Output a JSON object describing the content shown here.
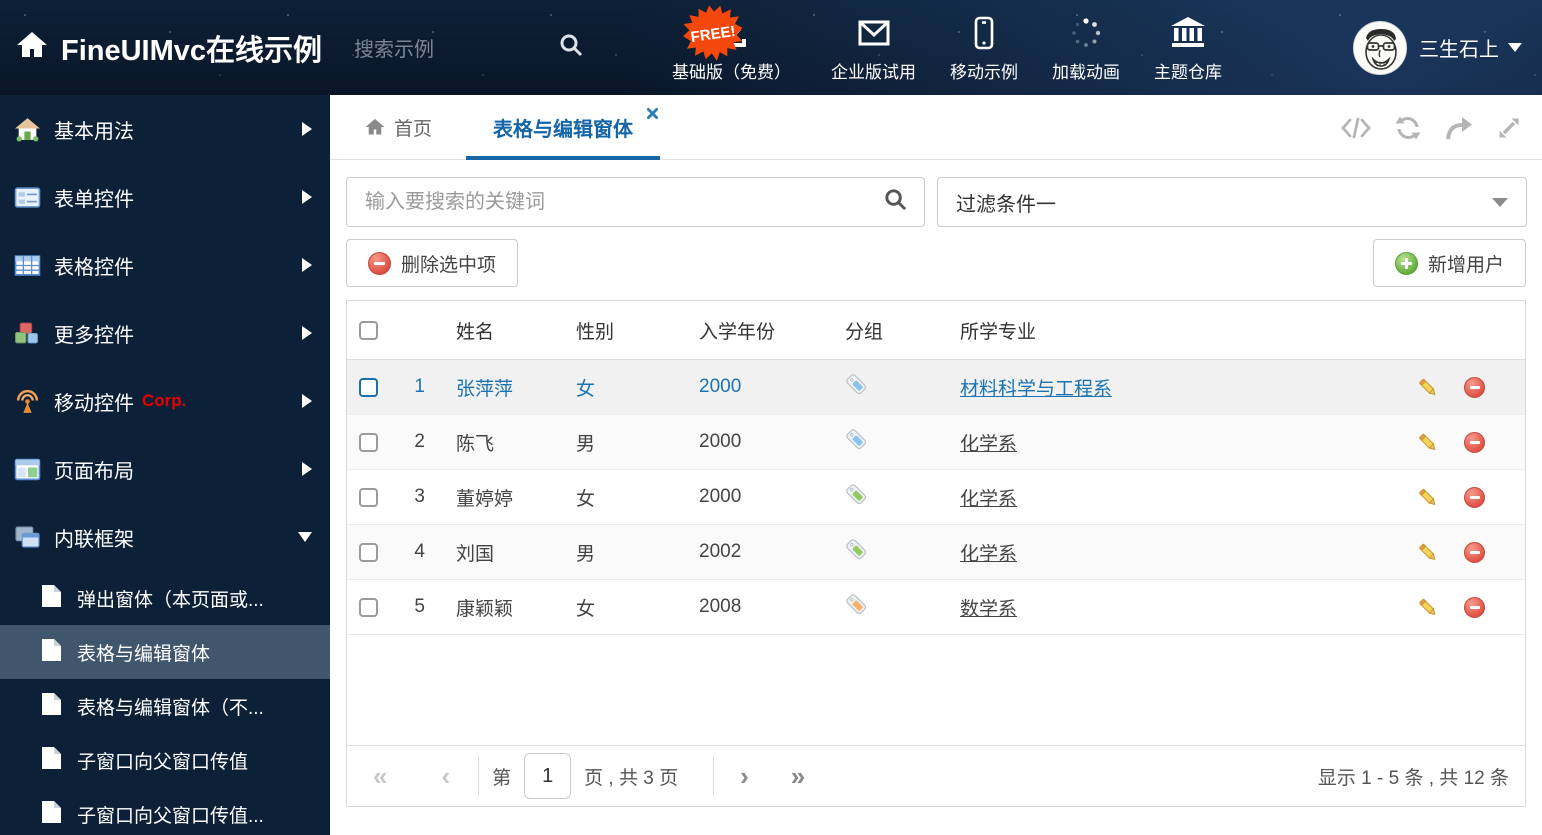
{
  "colors": {
    "accent_blue": "#1565a7",
    "selected_row_blue": "#1b74b2",
    "header_bg": "#0b1b30",
    "free_badge_bg": "#f4470b",
    "delete_red": "#dd4f42",
    "add_green": "#62ad3c",
    "tag_blue": "#85c5ef",
    "tag_green": "#94ca62",
    "tag_orange": "#f7b267",
    "corp_red": "#e80000"
  },
  "header": {
    "title": "FineUIMvc在线示例",
    "search_placeholder": "搜索示例",
    "free_badge": "FREE!",
    "nav_items": [
      {
        "label": "基础版（免费）"
      },
      {
        "label": "企业版试用"
      },
      {
        "label": "移动示例"
      },
      {
        "label": "加载动画"
      },
      {
        "label": "主题仓库"
      }
    ],
    "username": "三生石上"
  },
  "sidebar": {
    "items": [
      {
        "label": "基本用法"
      },
      {
        "label": "表单控件"
      },
      {
        "label": "表格控件"
      },
      {
        "label": "更多控件"
      },
      {
        "label": "移动控件",
        "badge": "Corp."
      },
      {
        "label": "页面布局"
      },
      {
        "label": "内联框架"
      }
    ],
    "subitems": [
      {
        "label": "弹出窗体（本页面或..."
      },
      {
        "label": "表格与编辑窗体"
      },
      {
        "label": "表格与编辑窗体（不..."
      },
      {
        "label": "子窗口向父窗口传值"
      },
      {
        "label": "子窗口向父窗口传值..."
      }
    ]
  },
  "tabs": {
    "home_label": "首页",
    "active_label": "表格与编辑窗体"
  },
  "filter": {
    "search_placeholder": "输入要搜索的关键词",
    "dropdown_value": "过滤条件一"
  },
  "toolbar": {
    "delete_label": "删除选中项",
    "add_label": "新增用户"
  },
  "table": {
    "columns": {
      "name": "姓名",
      "gender": "性别",
      "year": "入学年份",
      "group": "分组",
      "major": "所学专业"
    },
    "rows": [
      {
        "num": "1",
        "name": "张萍萍",
        "gender": "女",
        "year": "2000",
        "major": "材料科学与工程系",
        "tag": "blue",
        "selected": true
      },
      {
        "num": "2",
        "name": "陈飞",
        "gender": "男",
        "year": "2000",
        "major": "化学系",
        "tag": "blue"
      },
      {
        "num": "3",
        "name": "董婷婷",
        "gender": "女",
        "year": "2000",
        "major": "化学系",
        "tag": "green"
      },
      {
        "num": "4",
        "name": "刘国",
        "gender": "男",
        "year": "2002",
        "major": "化学系",
        "tag": "green"
      },
      {
        "num": "5",
        "name": "康颖颖",
        "gender": "女",
        "year": "2008",
        "major": "数学系",
        "tag": "orange"
      }
    ]
  },
  "pagination": {
    "first": "«",
    "prev": "‹",
    "next": "›",
    "last": "»",
    "page_label_prefix": "第",
    "page_value": "1",
    "page_label_suffix": "页 , 共 3 页",
    "summary": "显示 1 - 5 条 , 共 12 条"
  }
}
